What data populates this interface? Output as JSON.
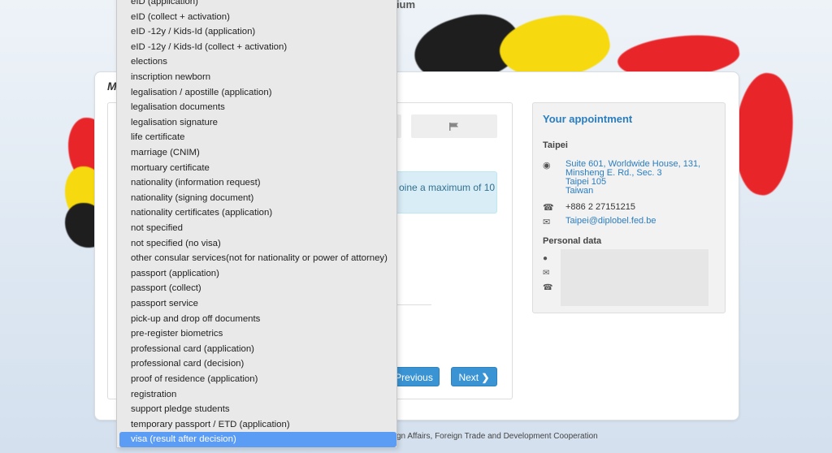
{
  "header": {
    "title_fragment": "gium"
  },
  "panel": {
    "heading_letter": "M"
  },
  "info_alert": {
    "text": "oine a maximum of 10"
  },
  "buttons": {
    "previous": "Previous",
    "next": "Next"
  },
  "icons": {
    "flag": "flag-icon",
    "chevron": "chevron-right-icon",
    "location": "map-pin-icon",
    "phone": "phone-icon",
    "mail": "envelope-icon",
    "user": "user-icon"
  },
  "appointment": {
    "title": "Your appointment",
    "city": "Taipei",
    "address_lines": [
      "Suite 601, Worldwide House, 131,",
      "Minsheng E. Rd., Sec. 3",
      "Taipei 105",
      "Taiwan"
    ],
    "phone": "+886 2 27151215",
    "email": "Taipei@diplobel.fed.be",
    "personal_title": "Personal data"
  },
  "footer": {
    "text": "gn Affairs, Foreign Trade and Development Cooperation"
  },
  "dropdown": {
    "items": [
      "eID (application)",
      "eID (collect + activation)",
      "eID -12y / Kids-Id (application)",
      "eID -12y / Kids-Id (collect + activation)",
      "elections",
      "inscription newborn",
      "legalisation / apostille (application)",
      "legalisation documents",
      "legalisation signature",
      "life certificate",
      "marriage (CNIM)",
      "mortuary certificate",
      "nationality (information request)",
      "nationality (signing document)",
      "nationality certificates (application)",
      "not specified",
      "not specified (no visa)",
      "other consular services(not for nationality or power of attorney)",
      "passport (application)",
      "passport (collect)",
      "passport service",
      "pick-up and drop off documents",
      "pre-register biometrics",
      "professional card (application)",
      "professional card (decision)",
      "proof of residence (application)",
      "registration",
      "support pledge students",
      "temporary passport / ETD (application)",
      "visa (result after decision)"
    ],
    "selected_index": 29
  },
  "colors": {
    "accent": "#3a94d4",
    "selected": "#5b9cf5",
    "info_bg": "#d9edf7"
  }
}
